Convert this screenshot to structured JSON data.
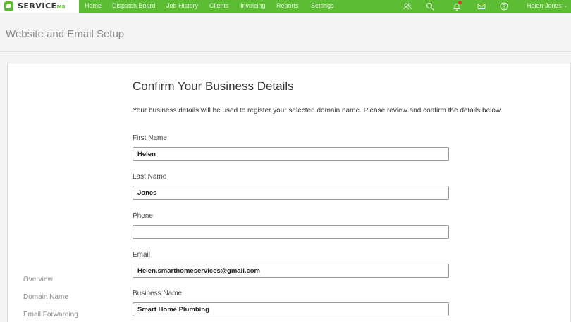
{
  "app": {
    "logo_text": "SERVICE",
    "logo_suffix": "M8"
  },
  "nav": {
    "items": [
      {
        "label": "Home"
      },
      {
        "label": "Dispatch Board"
      },
      {
        "label": "Job History"
      },
      {
        "label": "Clients"
      },
      {
        "label": "Invoicing"
      },
      {
        "label": "Reports"
      },
      {
        "label": "Settings"
      }
    ],
    "icons": [
      "people-icon",
      "search-icon",
      "bell-icon",
      "mail-icon",
      "help-icon"
    ],
    "user_name": "Helen Jones",
    "user_chevron": "⌄"
  },
  "page": {
    "title": "Website and Email Setup"
  },
  "sidebar": {
    "items": [
      {
        "label": "Overview"
      },
      {
        "label": "Domain Name"
      },
      {
        "label": "Email Forwarding"
      }
    ]
  },
  "form": {
    "heading": "Confirm Your Business Details",
    "description": "Your business details will be used to register your selected domain name. Please review and confirm the details below.",
    "fields": [
      {
        "label": "First Name",
        "value": "Helen"
      },
      {
        "label": "Last Name",
        "value": "Jones"
      },
      {
        "label": "Phone",
        "value": ""
      },
      {
        "label": "Email",
        "value": "Helen.smarthomeservices@gmail.com"
      },
      {
        "label": "Business Name",
        "value": "Smart Home Plumbing"
      }
    ]
  },
  "colors": {
    "brand_green": "#5cbc34",
    "notification_red": "#e03a3a"
  }
}
